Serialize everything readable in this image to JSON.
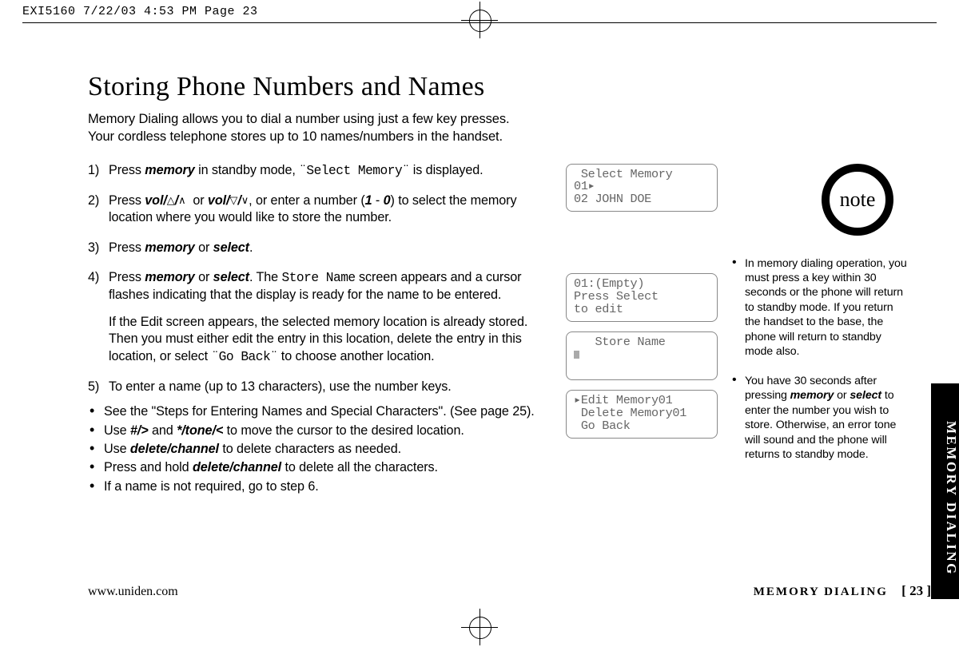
{
  "print_header": "EXI5160  7/22/03 4:53 PM  Page 23",
  "heading": "Storing Phone Numbers and Names",
  "intro_line1": "Memory Dialing allows you to dial a number using just a few key presses.",
  "intro_line2": "Your cordless telephone stores up to 10 names/numbers in the handset.",
  "steps": {
    "1a": "Press ",
    "1b": "memory",
    "1c": " in standby mode, ",
    "1d": "¨Select Memory¨",
    "1e": " is displayed.",
    "2a": "Press ",
    "2b": "vol/",
    "2c": " or ",
    "2d": "vol/",
    "2e": ", or enter a number (",
    "2f": "1",
    "2g": " - ",
    "2h": "0",
    "2i": ") to select the memory location where you would like to store the number.",
    "3a": "Press ",
    "3b": "memory",
    "3c": " or ",
    "3d": "select",
    "3e": ".",
    "4a": "Press ",
    "4b": "memory",
    "4c": " or ",
    "4d": "select",
    "4e": ". The ",
    "4f": "Store Name",
    "4g": " screen appears and a cursor flashes indicating that the display is ready for the name to be entered.",
    "4sub": "If the Edit screen appears, the selected memory location is already stored. Then you must either edit the entry in this location, delete the entry in this location, or select ",
    "4sub2": "¨Go Back¨",
    "4sub3": " to choose another location.",
    "5a": "To enter a name (up to 13 characters), use the number keys."
  },
  "bullets": {
    "b1": "See the \"Steps for Entering Names and Special Characters\". (See page 25).",
    "b2a": "Use ",
    "b2b": "#/",
    "b2c": " and ",
    "b2d": "/tone/",
    "b2e": " to move the cursor to the desired location.",
    "b3a": "Use ",
    "b3b": "delete/channel",
    "b3c": " to delete characters as needed.",
    "b4a": "Press and hold ",
    "b4b": "delete/channel",
    "b4c": " to delete all the characters.",
    "b5": "If a name is not required, go to step 6."
  },
  "screens": {
    "s1l1": " Select Memory",
    "s1l2": "01▸",
    "s1l3": "02 JOHN DOE",
    "s2l1": "01:(Empty)",
    "s2l2": "Press Select",
    "s2l3": "to edit",
    "s3l1": "   Store Name",
    "s4l1": "▸Edit Memory01",
    "s4l2": " Delete Memory01",
    "s4l3": " Go Back"
  },
  "note_label": "note",
  "side": {
    "n1": "In memory dialing operation, you must press a key within 30 seconds or the phone will return to standby mode. If you return the handset to the base, the phone will return to standby mode also.",
    "n2a": "You have 30 seconds after pressing ",
    "n2b": "memory",
    "n2c": " or ",
    "n2d": "select",
    "n2e": " to enter the number you wish to store. Otherwise, an error tone will sound and the phone will returns to standby mode."
  },
  "side_tab": "MEMORY DIALING",
  "footer_left": "www.uniden.com",
  "footer_right_a": "MEMORY DIALING",
  "footer_right_b": "[ 23 ]"
}
